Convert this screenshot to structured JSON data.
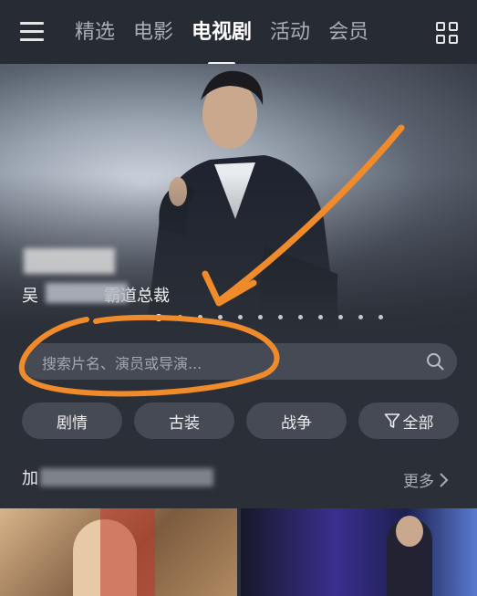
{
  "nav": {
    "tabs": [
      {
        "label": "精选"
      },
      {
        "label": "电影"
      },
      {
        "label": "电视剧"
      },
      {
        "label": "活动"
      },
      {
        "label": "会员"
      }
    ],
    "active_tab": "电视剧"
  },
  "hero": {
    "title": "",
    "subtitle": "吴　　　　霸道总裁",
    "carousel_count": 12,
    "carousel_active_index": 0
  },
  "search": {
    "placeholder": "搜索片名、演员或导演..."
  },
  "filters": [
    {
      "label": "剧情"
    },
    {
      "label": "古装"
    },
    {
      "label": "战争"
    },
    {
      "label": "全部"
    }
  ],
  "section": {
    "title": "加",
    "more_label": "更多"
  },
  "colors": {
    "background": "#2b2f37",
    "chip_bg": "#454a54",
    "annotation": "#f08b2c"
  },
  "icons": {
    "menu": "menu-icon",
    "grid": "grid-icon",
    "search": "search-icon",
    "filter": "filter-icon",
    "chevron": "chevron-right-icon"
  }
}
